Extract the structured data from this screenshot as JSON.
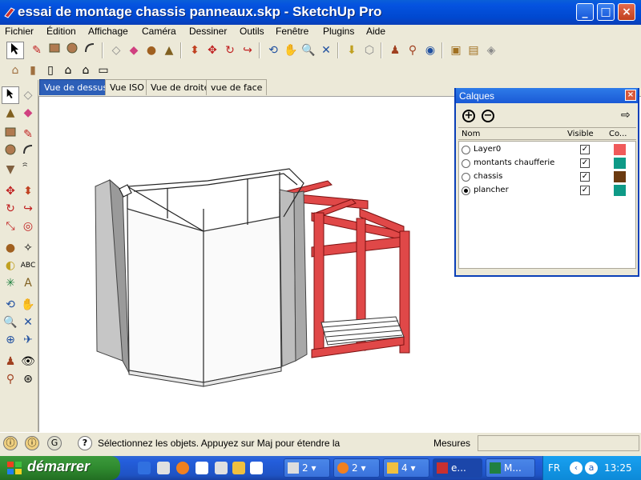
{
  "window": {
    "title": "essai de montage chassis panneaux.skp - SketchUp Pro",
    "buttons": {
      "minimize": "_",
      "maximize": "□",
      "close": "×"
    }
  },
  "menubar": [
    "Fichier",
    "Édition",
    "Affichage",
    "Caméra",
    "Dessiner",
    "Outils",
    "Fenêtre",
    "Plugins",
    "Aide"
  ],
  "toolbar": {
    "top_row": [
      "select-icon",
      "pencil-icon",
      "rectangle-icon",
      "circle-icon",
      "arc-icon",
      "eraser-icon",
      "paint-bucket-icon",
      "push-pull-icon",
      "tape-measure-icon",
      "move-icon",
      "offset-icon",
      "rotate-icon",
      "follow-me-icon",
      "orbit-icon",
      "pan-icon",
      "zoom-icon",
      "zoom-extents-icon",
      "previous-view-icon",
      "next-view-icon",
      "position-camera-icon",
      "walk-icon",
      "look-around-icon",
      "components-icon",
      "materials-icon",
      "styles-icon"
    ],
    "views_row": [
      "iso-view-icon",
      "top-view-icon",
      "front-view-icon",
      "right-view-icon",
      "back-view-icon",
      "left-view-icon"
    ]
  },
  "tabs": [
    {
      "label": "Vue de dessus",
      "active": true
    },
    {
      "label": "Vue ISO",
      "active": false
    },
    {
      "label": "Vue de droite",
      "active": false
    },
    {
      "label": "vue de face",
      "active": false
    }
  ],
  "calques": {
    "title": "Calques",
    "close": "×",
    "add_button": "+",
    "remove_button": "−",
    "headers": {
      "name": "Nom",
      "visible": "Visible",
      "color": "Co..."
    },
    "layers": [
      {
        "name": "Layer0",
        "active": false,
        "visible": true,
        "color": "#f05a5a"
      },
      {
        "name": "montants chaufferie",
        "active": false,
        "visible": true,
        "color": "#0e9a87"
      },
      {
        "name": "chassis",
        "active": false,
        "visible": true,
        "color": "#6b3a10"
      },
      {
        "name": "plancher",
        "active": true,
        "visible": true,
        "color": "#0e9a87"
      }
    ]
  },
  "statusbar": {
    "text": "Sélectionnez les objets. Appuyez sur Maj pour étendre la",
    "measures_label": "Mesures",
    "measures_value": ""
  },
  "taskbar": {
    "start_label": "démarrer",
    "groups": [
      {
        "label": "2",
        "icon": "printer-icon"
      },
      {
        "label": "2",
        "icon": "firefox-icon"
      },
      {
        "label": "4",
        "icon": "folder-icon"
      },
      {
        "label": "e...",
        "icon": "sketchup-icon",
        "active": true
      },
      {
        "label": "M...",
        "icon": "excel-icon"
      }
    ],
    "language": "FR",
    "clock": "13:25"
  },
  "colors": {
    "panel_gray": "#c8c8c8",
    "frame_red": "#e04848",
    "accent_blue": "#2d5fb8"
  }
}
